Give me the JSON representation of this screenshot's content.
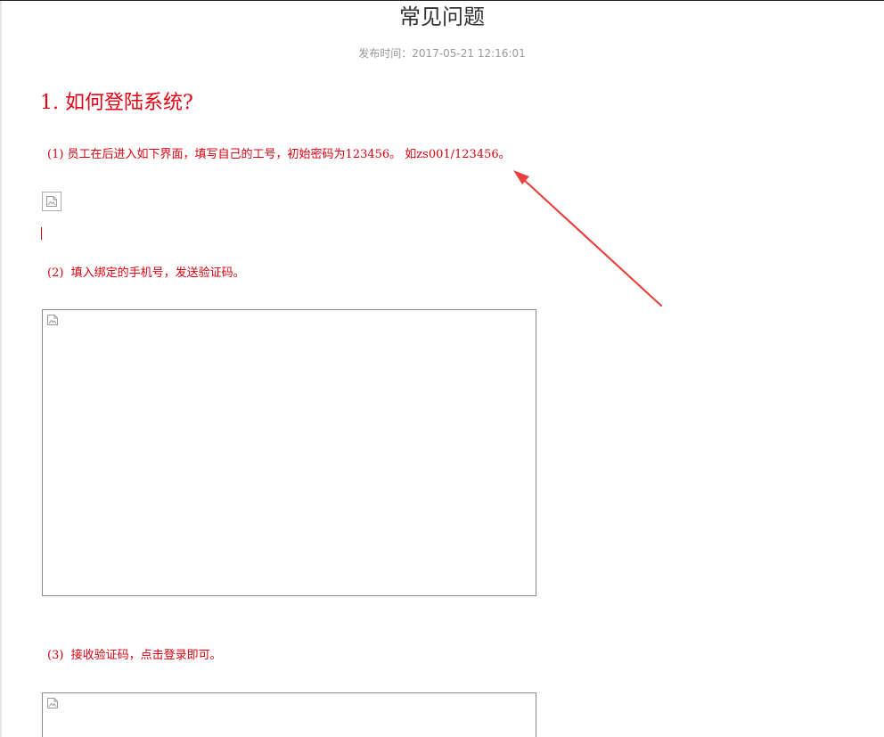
{
  "article": {
    "title": "常见问题",
    "publish_label": "发布时间：",
    "publish_time": "2017-05-21 12:16:01"
  },
  "section": {
    "heading": "1. 如何登陆系统?"
  },
  "steps": [
    {
      "text": "(1) 员工在后进入如下界面，填写自己的工号，初始密码为123456。 如zs001/123456。"
    },
    {
      "text": "(2)  填入绑定的手机号，发送验证码。"
    },
    {
      "text": "(3)  接收验证码，点击登录即可。"
    }
  ],
  "icons": {
    "image_placeholder": "broken-image-icon",
    "annotation": "red-arrow"
  },
  "colors": {
    "accent_red": "#e60012",
    "step_red": "#d9000d",
    "title": "#333333",
    "meta_gray": "#999999",
    "arrow_red": "#e8423f"
  }
}
